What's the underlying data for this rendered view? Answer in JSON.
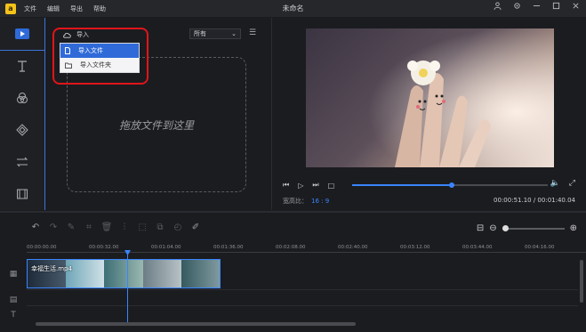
{
  "app": {
    "title": "未命名",
    "logo_char": "a"
  },
  "menu": [
    "文件",
    "编辑",
    "导出",
    "帮助"
  ],
  "window_controls": [
    "user-icon",
    "settings-icon",
    "minimize-icon",
    "maximize-icon",
    "close-icon"
  ],
  "rail": {
    "items": [
      "media-icon",
      "text-icon",
      "filter-icon",
      "overlay-icon",
      "transition-icon",
      "element-icon"
    ],
    "active_index": 0,
    "accent": "#2f6ad8"
  },
  "media": {
    "import_label": "导入",
    "filter_value": "所有",
    "drop_text": "拖放文件到这里",
    "import_menu": [
      "导入文件",
      "导入文件夹"
    ],
    "selected_menu_index": 0
  },
  "preview": {
    "aspect_label": "宽高比：",
    "aspect_value": "16 : 9",
    "current_time": "00:00:51.10",
    "total_time": "00:01:40.04",
    "progress": 0.51
  },
  "timeline": {
    "ruler": [
      "00:00:00.00",
      "00:00:32.00",
      "00:01:04.00",
      "00:01:36.00",
      "00:02:08.00",
      "00:02:40.00",
      "00:03:12.00",
      "00:03:44.00",
      "00:04:16.00"
    ],
    "clip_name": "幸福生活.mp4",
    "zoom_level": 0.0
  },
  "colors": {
    "accent": "#3a85ff",
    "highlight": "#e0151a",
    "background": "#1b1c20"
  }
}
